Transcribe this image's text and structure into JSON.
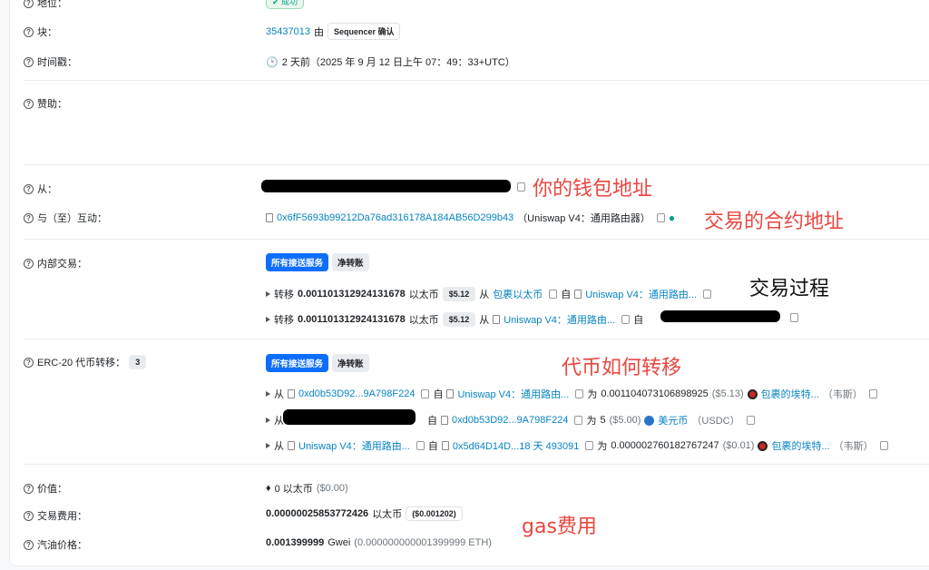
{
  "status": {
    "label": "地位：",
    "badge": "成功"
  },
  "block": {
    "label": "块：",
    "number": "35437013",
    "by": "由",
    "seq_badge": "Sequencer 确认"
  },
  "timestamp": {
    "label": "时间戳：",
    "value": "2 天前（2025 年 9 月 12 日上午 07：49：33+UTC）"
  },
  "sponsor": {
    "label": "赞助："
  },
  "from": {
    "label": "从："
  },
  "interact": {
    "label": "与（至）互动：",
    "address": "0x6fF5693b99212Da76ad316178A184AB56D299b43",
    "name": "（Uniswap V4：通用路由器）"
  },
  "internal": {
    "label": "内部交易：",
    "tab_all": "所有接送服务",
    "tab_net": "净转账",
    "rows": [
      {
        "pre": "转移",
        "amount": "0.001101312924131678",
        "unit": "以太币",
        "usd": "$5.12",
        "from_label": "从",
        "from": "包裹以太币",
        "to_label": "自",
        "to": "Uniswap V4：通用路由..."
      },
      {
        "pre": "转移",
        "amount": "0.001101312924131678",
        "unit": "以太币",
        "usd": "$5.12",
        "from_label": "从",
        "from": "Uniswap V4：通用路由...",
        "to_label": "自"
      }
    ]
  },
  "erc20": {
    "label": "ERC-20 代币转移：",
    "count": "3",
    "tab_all": "所有接送服务",
    "tab_net": "净转账",
    "rows": [
      {
        "from_label": "从",
        "from": "0xd0b53D92...9A798F224",
        "to_label": "自",
        "to": "Uniswap V4：通用路由...",
        "for_label": "为",
        "amount": "0.001104073106898925",
        "usd": "($5.13)",
        "token": "包裹的埃特...",
        "sym": "（韦斯）"
      },
      {
        "from_label": "从",
        "to_label": "自",
        "to": "0xd0b53D92...9A798F224",
        "for_label": "为",
        "amount": "5",
        "usd": "($5.00)",
        "token": "美元币",
        "sym": "（USDC）"
      },
      {
        "from_label": "从",
        "from": "Uniswap V4：通用路由...",
        "to_label": "自",
        "to": "0x5d64D14D...18 天 493091",
        "for_label": "为",
        "amount": "0.000002760182767247",
        "usd": "($0.01)",
        "token": "包裹的埃特...",
        "sym": "（韦斯）"
      }
    ]
  },
  "value": {
    "label": "价值：",
    "amount": "0 以太币",
    "usd": "($0.00)"
  },
  "fee": {
    "label": "交易费用：",
    "amount": "0.00000025853772426",
    "unit": "以太币",
    "usd": "($0.001202)"
  },
  "gas": {
    "label": "汽油价格：",
    "amount": "0.001399999",
    "unit": "Gwei",
    "eth": "(0.000000000001399999 ETH)"
  },
  "annotations": {
    "wallet": "你的钱包地址",
    "contract": "交易的合约地址",
    "process": "交易过程",
    "token_transfer": "代币如何转移",
    "gas_fee": "gas费用"
  }
}
